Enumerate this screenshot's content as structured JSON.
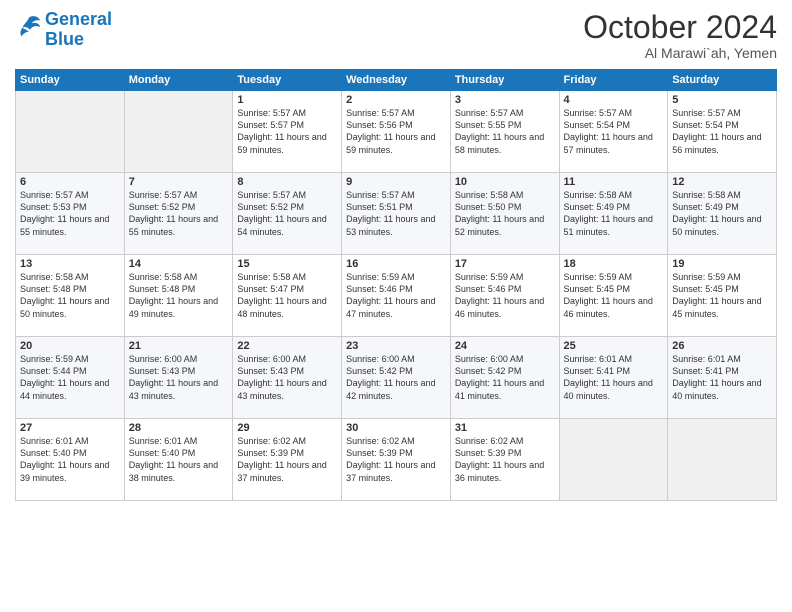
{
  "logo": {
    "line1": "General",
    "line2": "Blue"
  },
  "title": "October 2024",
  "subtitle": "Al Marawi`ah, Yemen",
  "days_header": [
    "Sunday",
    "Monday",
    "Tuesday",
    "Wednesday",
    "Thursday",
    "Friday",
    "Saturday"
  ],
  "weeks": [
    [
      {
        "num": "",
        "sunrise": "",
        "sunset": "",
        "daylight": ""
      },
      {
        "num": "",
        "sunrise": "",
        "sunset": "",
        "daylight": ""
      },
      {
        "num": "1",
        "sunrise": "Sunrise: 5:57 AM",
        "sunset": "Sunset: 5:57 PM",
        "daylight": "Daylight: 11 hours and 59 minutes."
      },
      {
        "num": "2",
        "sunrise": "Sunrise: 5:57 AM",
        "sunset": "Sunset: 5:56 PM",
        "daylight": "Daylight: 11 hours and 59 minutes."
      },
      {
        "num": "3",
        "sunrise": "Sunrise: 5:57 AM",
        "sunset": "Sunset: 5:55 PM",
        "daylight": "Daylight: 11 hours and 58 minutes."
      },
      {
        "num": "4",
        "sunrise": "Sunrise: 5:57 AM",
        "sunset": "Sunset: 5:54 PM",
        "daylight": "Daylight: 11 hours and 57 minutes."
      },
      {
        "num": "5",
        "sunrise": "Sunrise: 5:57 AM",
        "sunset": "Sunset: 5:54 PM",
        "daylight": "Daylight: 11 hours and 56 minutes."
      }
    ],
    [
      {
        "num": "6",
        "sunrise": "Sunrise: 5:57 AM",
        "sunset": "Sunset: 5:53 PM",
        "daylight": "Daylight: 11 hours and 55 minutes."
      },
      {
        "num": "7",
        "sunrise": "Sunrise: 5:57 AM",
        "sunset": "Sunset: 5:52 PM",
        "daylight": "Daylight: 11 hours and 55 minutes."
      },
      {
        "num": "8",
        "sunrise": "Sunrise: 5:57 AM",
        "sunset": "Sunset: 5:52 PM",
        "daylight": "Daylight: 11 hours and 54 minutes."
      },
      {
        "num": "9",
        "sunrise": "Sunrise: 5:57 AM",
        "sunset": "Sunset: 5:51 PM",
        "daylight": "Daylight: 11 hours and 53 minutes."
      },
      {
        "num": "10",
        "sunrise": "Sunrise: 5:58 AM",
        "sunset": "Sunset: 5:50 PM",
        "daylight": "Daylight: 11 hours and 52 minutes."
      },
      {
        "num": "11",
        "sunrise": "Sunrise: 5:58 AM",
        "sunset": "Sunset: 5:49 PM",
        "daylight": "Daylight: 11 hours and 51 minutes."
      },
      {
        "num": "12",
        "sunrise": "Sunrise: 5:58 AM",
        "sunset": "Sunset: 5:49 PM",
        "daylight": "Daylight: 11 hours and 50 minutes."
      }
    ],
    [
      {
        "num": "13",
        "sunrise": "Sunrise: 5:58 AM",
        "sunset": "Sunset: 5:48 PM",
        "daylight": "Daylight: 11 hours and 50 minutes."
      },
      {
        "num": "14",
        "sunrise": "Sunrise: 5:58 AM",
        "sunset": "Sunset: 5:48 PM",
        "daylight": "Daylight: 11 hours and 49 minutes."
      },
      {
        "num": "15",
        "sunrise": "Sunrise: 5:58 AM",
        "sunset": "Sunset: 5:47 PM",
        "daylight": "Daylight: 11 hours and 48 minutes."
      },
      {
        "num": "16",
        "sunrise": "Sunrise: 5:59 AM",
        "sunset": "Sunset: 5:46 PM",
        "daylight": "Daylight: 11 hours and 47 minutes."
      },
      {
        "num": "17",
        "sunrise": "Sunrise: 5:59 AM",
        "sunset": "Sunset: 5:46 PM",
        "daylight": "Daylight: 11 hours and 46 minutes."
      },
      {
        "num": "18",
        "sunrise": "Sunrise: 5:59 AM",
        "sunset": "Sunset: 5:45 PM",
        "daylight": "Daylight: 11 hours and 46 minutes."
      },
      {
        "num": "19",
        "sunrise": "Sunrise: 5:59 AM",
        "sunset": "Sunset: 5:45 PM",
        "daylight": "Daylight: 11 hours and 45 minutes."
      }
    ],
    [
      {
        "num": "20",
        "sunrise": "Sunrise: 5:59 AM",
        "sunset": "Sunset: 5:44 PM",
        "daylight": "Daylight: 11 hours and 44 minutes."
      },
      {
        "num": "21",
        "sunrise": "Sunrise: 6:00 AM",
        "sunset": "Sunset: 5:43 PM",
        "daylight": "Daylight: 11 hours and 43 minutes."
      },
      {
        "num": "22",
        "sunrise": "Sunrise: 6:00 AM",
        "sunset": "Sunset: 5:43 PM",
        "daylight": "Daylight: 11 hours and 43 minutes."
      },
      {
        "num": "23",
        "sunrise": "Sunrise: 6:00 AM",
        "sunset": "Sunset: 5:42 PM",
        "daylight": "Daylight: 11 hours and 42 minutes."
      },
      {
        "num": "24",
        "sunrise": "Sunrise: 6:00 AM",
        "sunset": "Sunset: 5:42 PM",
        "daylight": "Daylight: 11 hours and 41 minutes."
      },
      {
        "num": "25",
        "sunrise": "Sunrise: 6:01 AM",
        "sunset": "Sunset: 5:41 PM",
        "daylight": "Daylight: 11 hours and 40 minutes."
      },
      {
        "num": "26",
        "sunrise": "Sunrise: 6:01 AM",
        "sunset": "Sunset: 5:41 PM",
        "daylight": "Daylight: 11 hours and 40 minutes."
      }
    ],
    [
      {
        "num": "27",
        "sunrise": "Sunrise: 6:01 AM",
        "sunset": "Sunset: 5:40 PM",
        "daylight": "Daylight: 11 hours and 39 minutes."
      },
      {
        "num": "28",
        "sunrise": "Sunrise: 6:01 AM",
        "sunset": "Sunset: 5:40 PM",
        "daylight": "Daylight: 11 hours and 38 minutes."
      },
      {
        "num": "29",
        "sunrise": "Sunrise: 6:02 AM",
        "sunset": "Sunset: 5:39 PM",
        "daylight": "Daylight: 11 hours and 37 minutes."
      },
      {
        "num": "30",
        "sunrise": "Sunrise: 6:02 AM",
        "sunset": "Sunset: 5:39 PM",
        "daylight": "Daylight: 11 hours and 37 minutes."
      },
      {
        "num": "31",
        "sunrise": "Sunrise: 6:02 AM",
        "sunset": "Sunset: 5:39 PM",
        "daylight": "Daylight: 11 hours and 36 minutes."
      },
      {
        "num": "",
        "sunrise": "",
        "sunset": "",
        "daylight": ""
      },
      {
        "num": "",
        "sunrise": "",
        "sunset": "",
        "daylight": ""
      }
    ]
  ]
}
